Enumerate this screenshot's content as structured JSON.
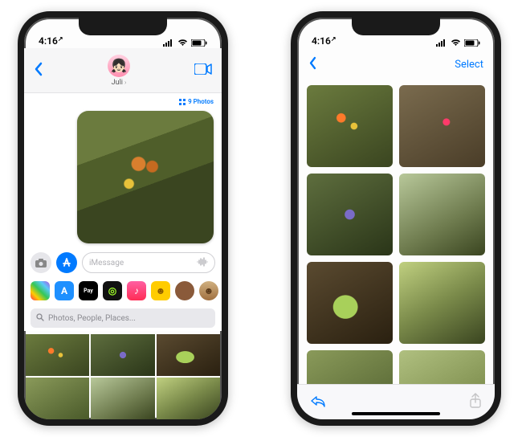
{
  "status": {
    "time": "4:16",
    "arrow": "↗"
  },
  "left": {
    "contact_name": "Juli",
    "photos_link": "9 Photos",
    "placeholder": "iMessage",
    "search_placeholder": "Photos, People, Places...",
    "apps": [
      {
        "name": "photos-app-icon",
        "bg": "linear-gradient(45deg,#ff2d55,#ffcc00,#34c759,#5ac8fa,#af52de)",
        "glyph": ""
      },
      {
        "name": "appstore-app-icon",
        "bg": "#1e90ff",
        "glyph": "A",
        "color": "#fff"
      },
      {
        "name": "applepay-app-icon",
        "bg": "#000",
        "glyph": "Pay",
        "color": "#fff",
        "fs": "7px"
      },
      {
        "name": "fitness-app-icon",
        "bg": "#111",
        "glyph": "◎",
        "color": "#a0ff2a"
      },
      {
        "name": "music-app-icon",
        "bg": "linear-gradient(#ff5fa2,#ff2d55)",
        "glyph": "♪",
        "color": "#fff"
      },
      {
        "name": "memoji-app-icon",
        "bg": "#ffcc00",
        "glyph": "☻",
        "color": "#8a5a00"
      },
      {
        "name": "avatar-app-icon",
        "bg": "#8a5a3a",
        "glyph": "",
        "round": true
      },
      {
        "name": "memoji2-app-icon",
        "bg": "linear-gradient(#d0b080,#a07040)",
        "glyph": "☻",
        "color": "#5a3a1a",
        "round": true
      }
    ],
    "picker": [
      "p1",
      "p3",
      "p5",
      "p7",
      "p4",
      "p6"
    ]
  },
  "right": {
    "select_label": "Select",
    "grid": [
      "p1",
      "p2",
      "p3",
      "p4",
      "p5",
      "p6",
      "p7",
      "p8"
    ]
  }
}
